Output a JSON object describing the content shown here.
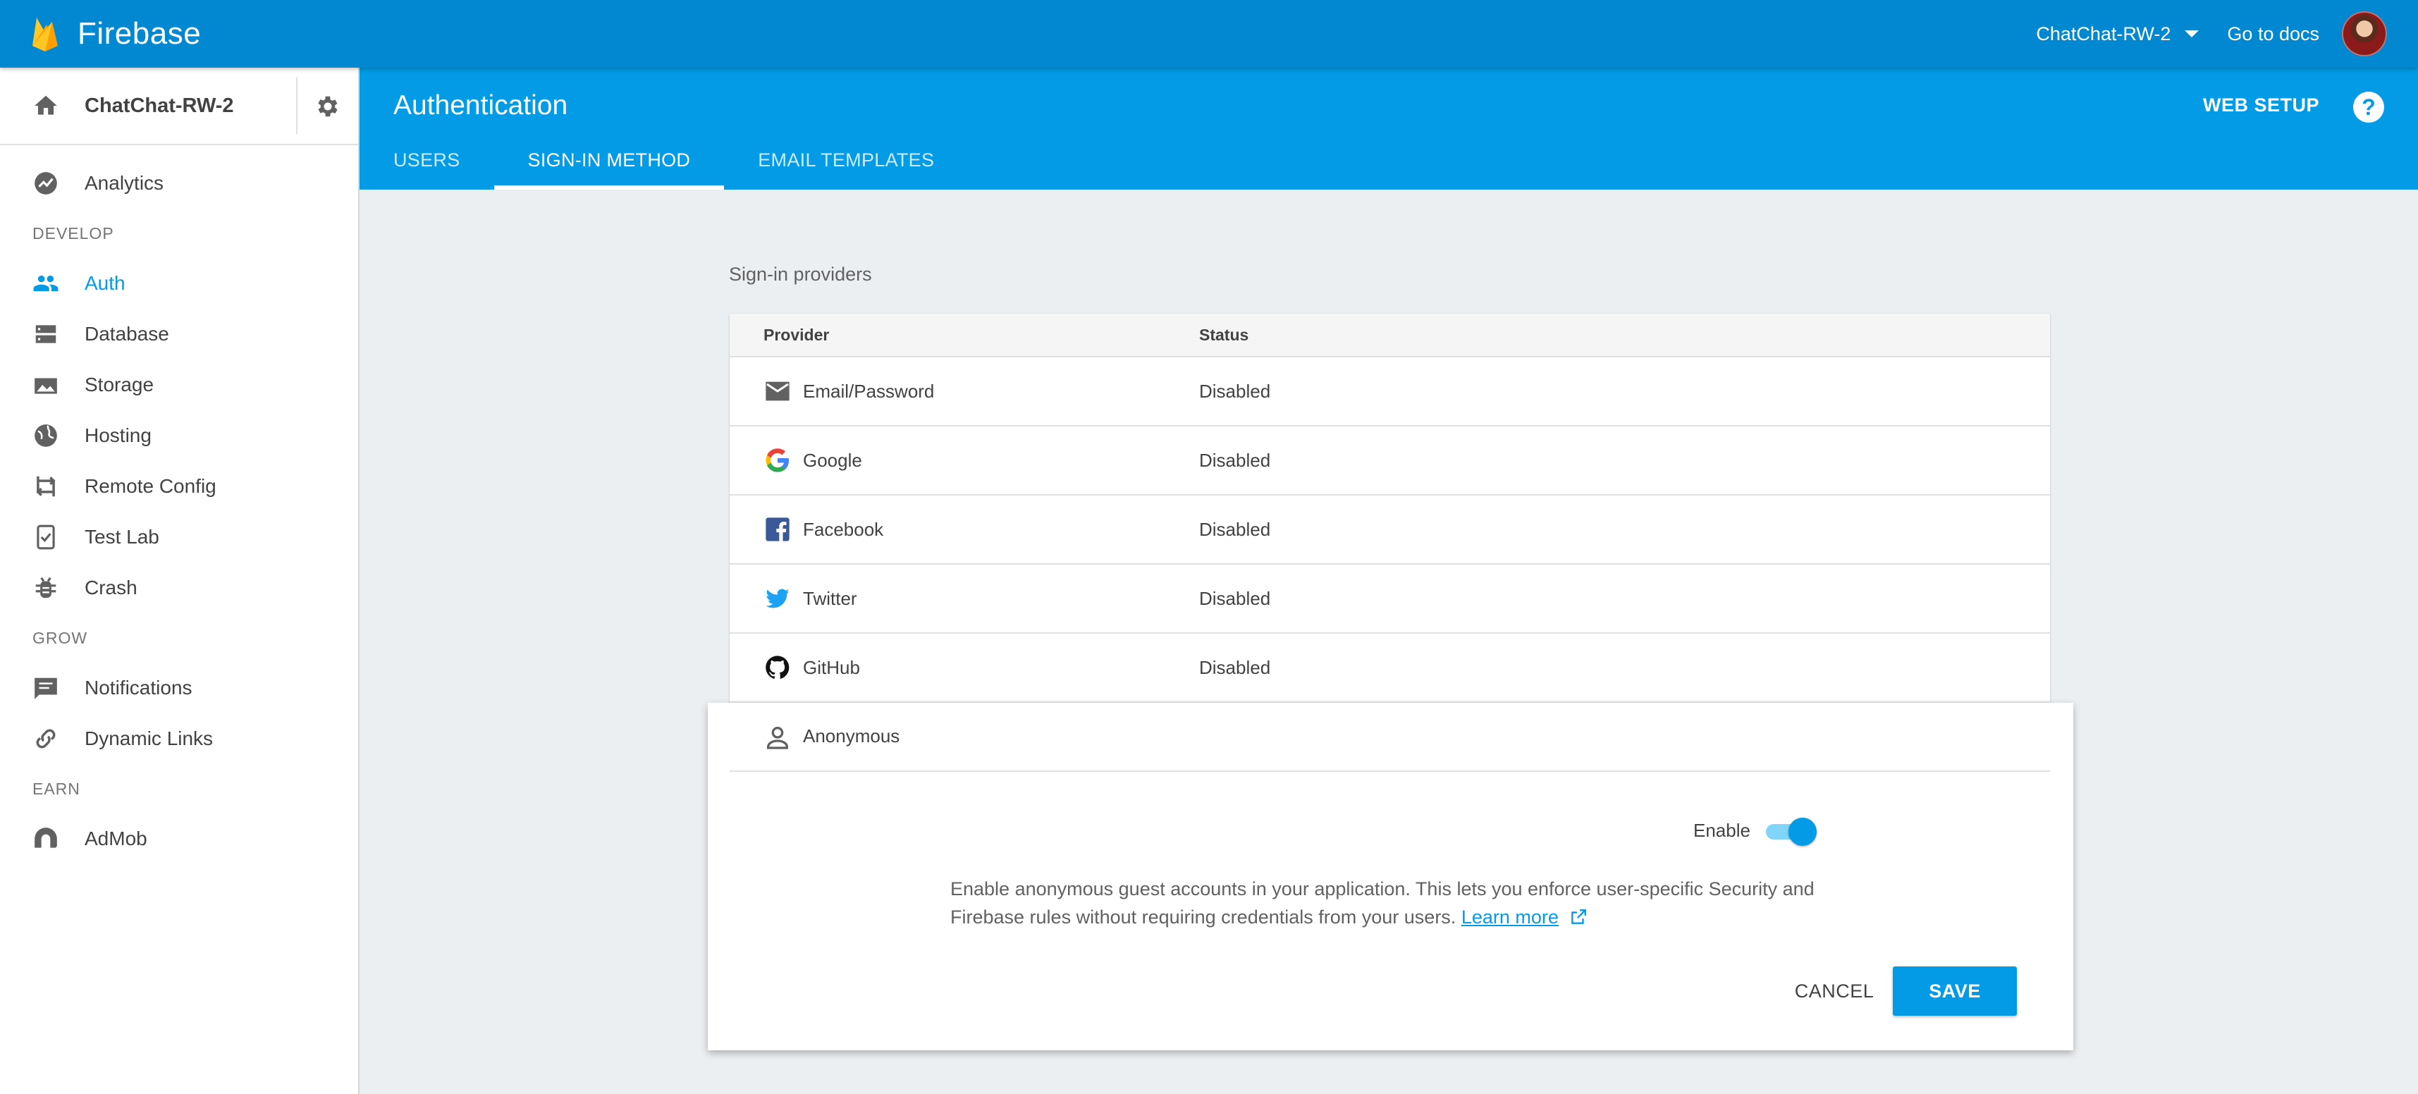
{
  "app": {
    "name": "Firebase"
  },
  "topbar": {
    "project_select": "ChatChat-RW-2",
    "go_to_docs": "Go to docs"
  },
  "sidebar": {
    "project_name": "ChatChat-RW-2",
    "items": [
      {
        "label": "Analytics",
        "icon": "analytics-icon"
      },
      {
        "section": "DEVELOP"
      },
      {
        "label": "Auth",
        "icon": "people-icon",
        "active": true
      },
      {
        "label": "Database",
        "icon": "database-icon"
      },
      {
        "label": "Storage",
        "icon": "image-icon"
      },
      {
        "label": "Hosting",
        "icon": "globe-icon"
      },
      {
        "label": "Remote Config",
        "icon": "swap-icon"
      },
      {
        "label": "Test Lab",
        "icon": "checklist-icon"
      },
      {
        "label": "Crash",
        "icon": "bug-icon"
      },
      {
        "section": "GROW"
      },
      {
        "label": "Notifications",
        "icon": "message-icon"
      },
      {
        "label": "Dynamic Links",
        "icon": "link-icon"
      },
      {
        "section": "EARN"
      },
      {
        "label": "AdMob",
        "icon": "admob-icon"
      }
    ]
  },
  "header": {
    "title": "Authentication",
    "web_setup": "WEB SETUP",
    "help": "?",
    "tabs": [
      {
        "label": "USERS"
      },
      {
        "label": "SIGN-IN METHOD",
        "active": true
      },
      {
        "label": "EMAIL TEMPLATES"
      }
    ]
  },
  "providers": {
    "section_label": "Sign-in providers",
    "columns": {
      "provider": "Provider",
      "status": "Status"
    },
    "rows": [
      {
        "name": "Email/Password",
        "status": "Disabled",
        "icon": "email-icon"
      },
      {
        "name": "Google",
        "status": "Disabled",
        "icon": "google-icon"
      },
      {
        "name": "Facebook",
        "status": "Disabled",
        "icon": "facebook-icon"
      },
      {
        "name": "Twitter",
        "status": "Disabled",
        "icon": "twitter-icon"
      },
      {
        "name": "GitHub",
        "status": "Disabled",
        "icon": "github-icon"
      }
    ]
  },
  "anonymous_panel": {
    "name": "Anonymous",
    "icon": "person-icon",
    "enable_label": "Enable",
    "enabled": true,
    "description": "Enable anonymous guest accounts in your application. This lets you enforce user-specific Security and Firebase rules without requiring credentials from your users.",
    "learn_more": "Learn more",
    "cancel": "CANCEL",
    "save": "SAVE"
  },
  "colors": {
    "topbar": "#0288d1",
    "header": "#039be5",
    "accent": "#039be5",
    "background": "#eceff1"
  }
}
